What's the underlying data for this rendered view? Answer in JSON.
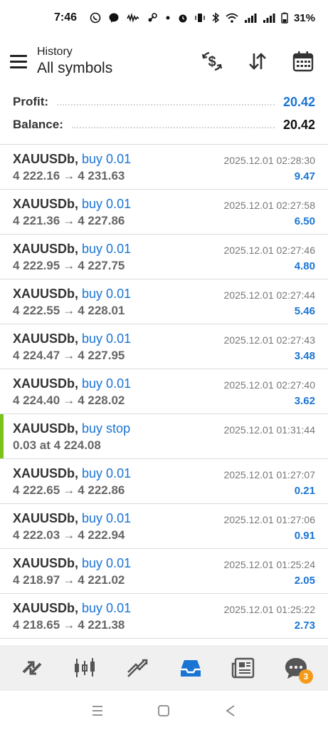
{
  "status_bar": {
    "time": "7:46",
    "battery": "31%",
    "left_icons": [
      "whatsapp-icon",
      "messenger-icon",
      "audio-wave-icon",
      "steam-icon",
      "dot-icon"
    ],
    "right_icons": [
      "alarm-icon",
      "vibrate-icon",
      "bluetooth-icon",
      "wifi-icon",
      "signal-icon",
      "signal-icon",
      "battery-icon"
    ]
  },
  "header": {
    "subtitle": "History",
    "title": "All symbols",
    "actions": [
      "currency-filter-icon",
      "sort-icon",
      "calendar-icon"
    ]
  },
  "summary": {
    "profit_label": "Profit:",
    "profit_value": "20.42",
    "balance_label": "Balance:",
    "balance_value": "20.42"
  },
  "trades": [
    {
      "symbol": "XAUUSDb",
      "side": "buy 0.01",
      "open": "4 222.16",
      "close": "4 231.63",
      "time": "2025.12.01 02:28:30",
      "profit": "9.47"
    },
    {
      "symbol": "XAUUSDb",
      "side": "buy 0.01",
      "open": "4 221.36",
      "close": "4 227.86",
      "time": "2025.12.01 02:27:58",
      "profit": "6.50"
    },
    {
      "symbol": "XAUUSDb",
      "side": "buy 0.01",
      "open": "4 222.95",
      "close": "4 227.75",
      "time": "2025.12.01 02:27:46",
      "profit": "4.80"
    },
    {
      "symbol": "XAUUSDb",
      "side": "buy 0.01",
      "open": "4 222.55",
      "close": "4 228.01",
      "time": "2025.12.01 02:27:44",
      "profit": "5.46"
    },
    {
      "symbol": "XAUUSDb",
      "side": "buy 0.01",
      "open": "4 224.47",
      "close": "4 227.95",
      "time": "2025.12.01 02:27:43",
      "profit": "3.48"
    },
    {
      "symbol": "XAUUSDb",
      "side": "buy 0.01",
      "open": "4 224.40",
      "close": "4 228.02",
      "time": "2025.12.01 02:27:40",
      "profit": "3.62"
    },
    {
      "symbol": "XAUUSDb",
      "side": "buy stop",
      "detail": "0.03 at 4 224.08",
      "time": "2025.12.01 01:31:44",
      "pending": true
    },
    {
      "symbol": "XAUUSDb",
      "side": "buy 0.01",
      "open": "4 222.65",
      "close": "4 222.86",
      "time": "2025.12.01 01:27:07",
      "profit": "0.21"
    },
    {
      "symbol": "XAUUSDb",
      "side": "buy 0.01",
      "open": "4 222.03",
      "close": "4 222.94",
      "time": "2025.12.01 01:27:06",
      "profit": "0.91"
    },
    {
      "symbol": "XAUUSDb",
      "side": "buy 0.01",
      "open": "4 218.97",
      "close": "4 221.02",
      "time": "2025.12.01 01:25:24",
      "profit": "2.05"
    },
    {
      "symbol": "XAUUSDb",
      "side": "buy 0.01",
      "open": "4 218.65",
      "close": "4 221.38",
      "time": "2025.12.01 01:25:22",
      "profit": "2.73"
    }
  ],
  "bottom_nav": {
    "items": [
      "quotes-icon",
      "chart-icon",
      "trade-icon",
      "history-icon",
      "news-icon",
      "messages-icon"
    ],
    "active": "history-icon",
    "messages_badge": "3"
  },
  "colors": {
    "accent_blue": "#1a74d4",
    "pending_marker": "#7cc21d",
    "badge_orange": "#f59a18"
  }
}
